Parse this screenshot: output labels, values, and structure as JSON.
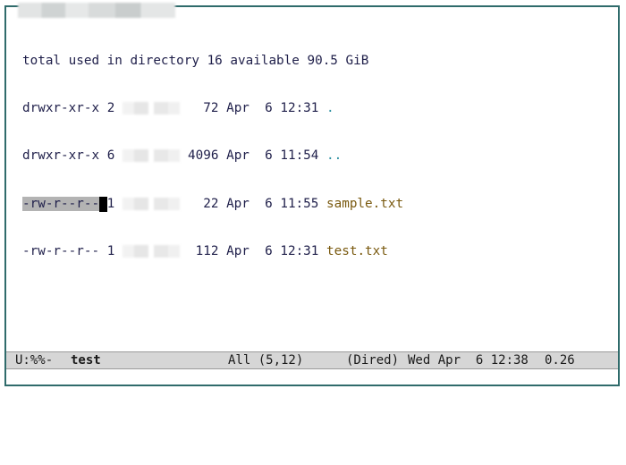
{
  "header": {
    "total_line": "total used in directory 16 available 90.5 GiB"
  },
  "entries": [
    {
      "perms": "drwxr-xr-x",
      "links": "2",
      "size": "72",
      "month": "Apr",
      "day": "6",
      "time": "12:31",
      "name": "."
    },
    {
      "perms": "drwxr-xr-x",
      "links": "6",
      "size": "4096",
      "month": "Apr",
      "day": "6",
      "time": "11:54",
      "name": ".."
    },
    {
      "perms": "-rw-r--r--",
      "links": "1",
      "size": "22",
      "month": "Apr",
      "day": "6",
      "time": "11:55",
      "name": "sample.txt"
    },
    {
      "perms": "-rw-r--r--",
      "links": "1",
      "size": "112",
      "month": "Apr",
      "day": "6",
      "time": "12:31",
      "name": "test.txt"
    }
  ],
  "modeline": {
    "status": "U:%%-",
    "buffer": "test",
    "position": "All (5,12)",
    "mode": "(Dired)",
    "datetime": "Wed Apr  6 12:38",
    "load": "0.26"
  }
}
